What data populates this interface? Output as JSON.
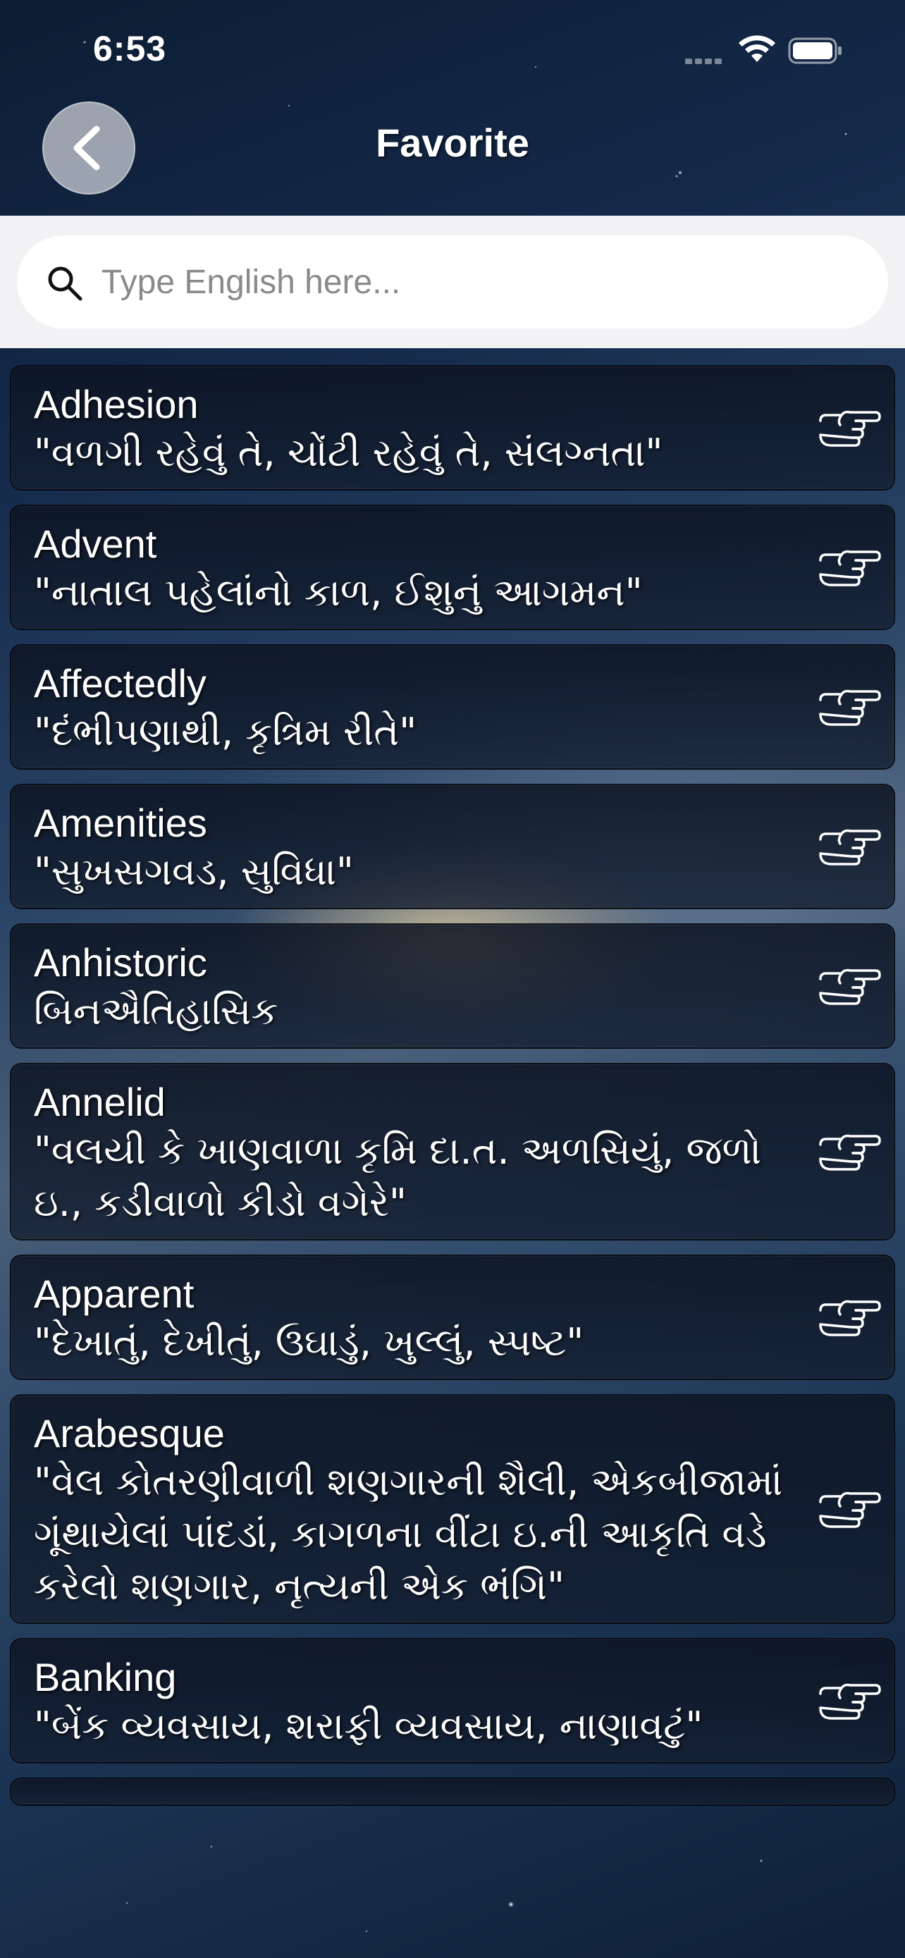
{
  "status_bar": {
    "time": "6:53"
  },
  "header": {
    "title": "Favorite",
    "back_icon": "chevron-left-icon"
  },
  "search": {
    "placeholder": "Type English here...",
    "value": "",
    "icon": "search-icon"
  },
  "favorites": [
    {
      "word": "Adhesion",
      "meaning": "\"વળગી રહેવું તે, ચોંટી રહેવું તે, સંલગ્નતા\""
    },
    {
      "word": "Advent",
      "meaning": "\"નાતાલ પહેલાંનો કાળ, ઈશુનું આગમન\""
    },
    {
      "word": "Affectedly",
      "meaning": "\"દંભીપણાથી, કૃત્રિમ રીતે\""
    },
    {
      "word": "Amenities",
      "meaning": "\"સુખસગવડ, સુવિધા\""
    },
    {
      "word": "Anhistoric",
      "meaning": "બિનઐતિહાસિક"
    },
    {
      "word": "Annelid",
      "meaning": "\"વલયી કે ખાણવાળા કૃમિ દા.ત. અળસિયું, જળો ઇ., કડીવાળો કીડો વગેરે\""
    },
    {
      "word": "Apparent",
      "meaning": "\"દેખાતું, દેખીતું, ઉઘાડું, ખુલ્લું, સ્પષ્ટ\""
    },
    {
      "word": "Arabesque",
      "meaning": "\"વેલ કોતરણીવાળી શણગારની શૈલી, એકબીજામાં ગૂંથાયેલાં પાંદડાં, કાગળના વીંટા ઇ.ની આકૃતિ વડે કરેલો શણગાર, નૃત્યની એક ભંગિ\""
    },
    {
      "word": "Banking",
      "meaning": "\"બેંક વ્યવસાય, શરાફી વ્યવસાય, નાણાવટું\""
    }
  ],
  "row_icon": "pointing-hand-icon"
}
